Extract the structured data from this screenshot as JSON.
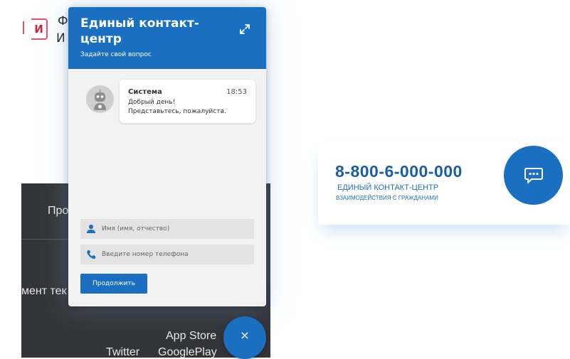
{
  "background_page": {
    "logo_letter": "И",
    "text_line1": "Ф",
    "text_line2": "И",
    "menu_item_1": "Про",
    "menu_item_2": "мент тек",
    "app_store": "App Store",
    "twitter": "Twitter",
    "google_play": "GooglePlay"
  },
  "banner": {
    "phone": "8-800-6-000-000",
    "line1": "ЕДИНЫЙ КОНТАКТ-ЦЕНТР",
    "line2": "ВЗАИМОДЕЙСТВИЯ С ГРАЖДАНАМИ",
    "chat_button_icon": "chat-bubble-icon"
  },
  "chat": {
    "title": "Единый контакт-центр",
    "subtitle": "Задайте свой вопрос",
    "expand_icon": "expand-icon",
    "message": {
      "sender": "Система",
      "time": "18:53",
      "line1": "Добрый день!",
      "line2": "Представьтесь, пожалуйста.",
      "avatar_icon": "robot-avatar-icon"
    },
    "name_field": {
      "placeholder": "Имя (имя, отчество)",
      "value": ""
    },
    "phone_field": {
      "placeholder": "Введите номер телефона",
      "value": ""
    },
    "submit_label": "Продолжить",
    "close_label": "×"
  },
  "colors": {
    "brand_blue": "#1a6fc0",
    "phone_blue": "#1a5fa0",
    "footer_dark": "#333438",
    "logo_red": "#e84f6c"
  }
}
